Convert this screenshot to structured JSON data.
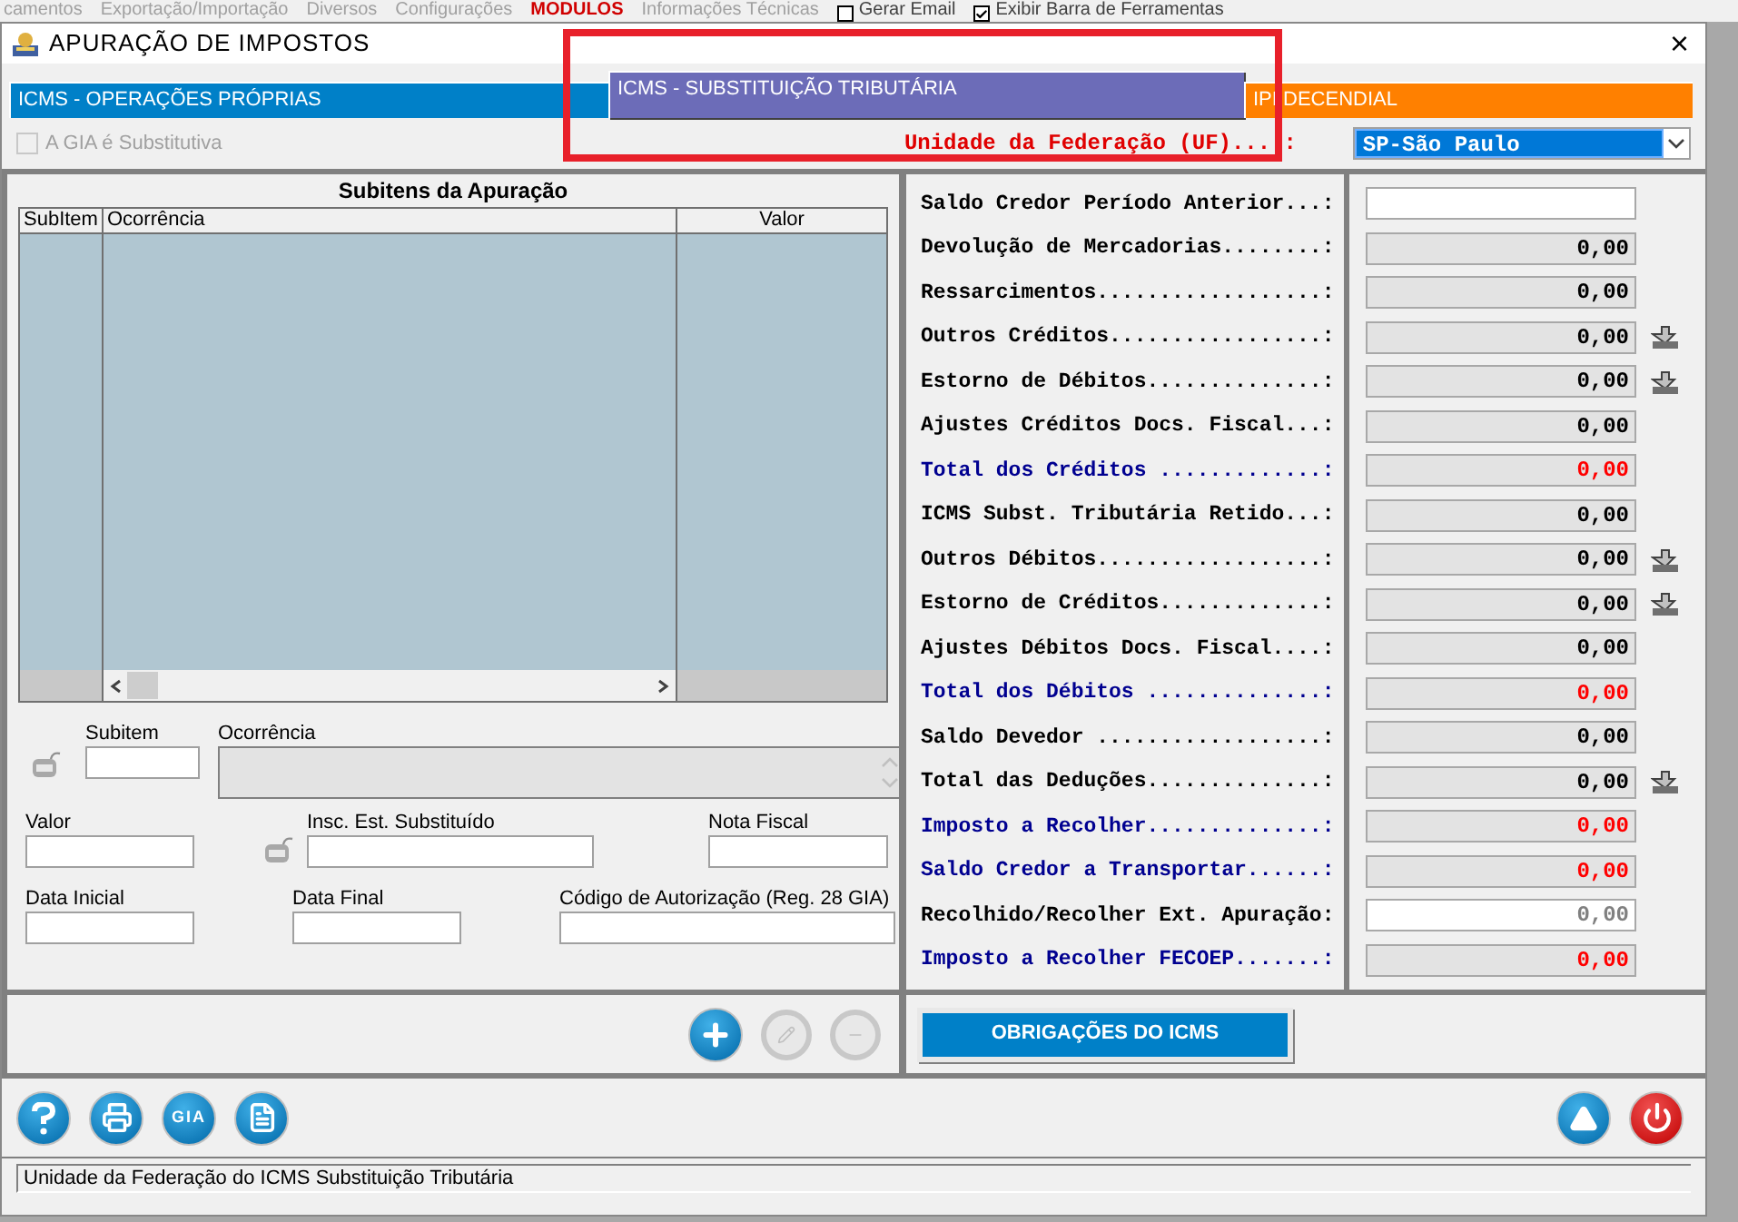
{
  "background_menu": {
    "items": [
      {
        "label": "camentos",
        "kind": "menu"
      },
      {
        "label": "Exportação/Importação",
        "kind": "menu"
      },
      {
        "label": "Diversos",
        "kind": "menu"
      },
      {
        "label": "Configurações",
        "kind": "menu"
      },
      {
        "label": "MODULOS",
        "kind": "highlight"
      },
      {
        "label": "Informações Técnicas",
        "kind": "menu"
      },
      {
        "label": "Gerar Email",
        "kind": "check",
        "checked": false
      },
      {
        "label": "Exibir Barra de Ferramentas",
        "kind": "check",
        "checked": true
      }
    ]
  },
  "window": {
    "title": "APURAÇÃO DE IMPOSTOS",
    "close": "×"
  },
  "tabs": [
    {
      "label": "ICMS - OPERAÇÕES PRÓPRIAS",
      "color": "#0080c8",
      "selected": false
    },
    {
      "label": "ICMS - SUBSTITUIÇÃO TRIBUTÁRIA",
      "color": "#6c6cb8",
      "selected": true
    },
    {
      "label": "IPI DECENDIAL",
      "color": "#ff8000",
      "selected": false
    }
  ],
  "gia_substitutiva": {
    "label": "A GIA é Substitutiva",
    "checked": false,
    "disabled": true
  },
  "uf": {
    "label": "Unidade da Federação (UF)....:",
    "value": "SP-São Paulo"
  },
  "subitens": {
    "title": "Subitens da Apuração",
    "columns": [
      "SubItem",
      "Ocorrência",
      "Valor"
    ]
  },
  "form": {
    "subitem": {
      "label": "Subitem"
    },
    "ocorrencia": {
      "label": "Ocorrência",
      "disabled": true
    },
    "valor": {
      "label": "Valor"
    },
    "insc": {
      "label": "Insc. Est. Substituído"
    },
    "nota": {
      "label": "Nota Fiscal"
    },
    "data_inicial": {
      "label": "Data Inicial"
    },
    "data_final": {
      "label": "Data Final"
    },
    "codigo": {
      "label": "Código de Autorização (Reg. 28 GIA)"
    }
  },
  "subitem_actions": [
    {
      "kind": "add",
      "disabled": false
    },
    {
      "kind": "edit",
      "disabled": true
    },
    {
      "kind": "delete",
      "disabled": true
    }
  ],
  "summary": [
    {
      "label": "Saldo Credor Período Anterior...:",
      "editable": true,
      "highlight": false,
      "detail": false
    },
    {
      "label": "Devolução de Mercadorias........:",
      "value": "0,00",
      "editable": false,
      "highlight": false,
      "detail": false
    },
    {
      "label": "Ressarcimentos..................:",
      "value": "0,00",
      "editable": false,
      "highlight": false,
      "detail": false
    },
    {
      "label": "Outros Créditos.................:",
      "value": "0,00",
      "editable": false,
      "highlight": false,
      "detail": true
    },
    {
      "label": "Estorno de Débitos..............:",
      "value": "0,00",
      "editable": false,
      "highlight": false,
      "detail": true
    },
    {
      "label": "Ajustes Créditos Docs. Fiscal...:",
      "value": "0,00",
      "editable": false,
      "highlight": false,
      "detail": false
    },
    {
      "label": "Total dos Créditos .............:",
      "value": "0,00",
      "editable": false,
      "highlight": true,
      "detail": false
    },
    {
      "label": "ICMS Subst. Tributária Retido...:",
      "value": "0,00",
      "editable": false,
      "highlight": false,
      "detail": false
    },
    {
      "label": "Outros Débitos..................:",
      "value": "0,00",
      "editable": false,
      "highlight": false,
      "detail": true
    },
    {
      "label": "Estorno de Créditos.............:",
      "value": "0,00",
      "editable": false,
      "highlight": false,
      "detail": true
    },
    {
      "label": "Ajustes Débitos Docs. Fiscal....:",
      "value": "0,00",
      "editable": false,
      "highlight": false,
      "detail": false
    },
    {
      "label": "Total dos Débitos ..............:",
      "value": "0,00",
      "editable": false,
      "highlight": true,
      "detail": false
    },
    {
      "label": "Saldo Devedor ..................:",
      "value": "0,00",
      "editable": false,
      "highlight": false,
      "detail": false
    },
    {
      "label": "Total das Deduções..............:",
      "value": "0,00",
      "editable": false,
      "highlight": false,
      "detail": true
    },
    {
      "label": "Imposto a Recolher..............:",
      "value": "0,00",
      "editable": false,
      "highlight": true,
      "detail": false
    },
    {
      "label": "Saldo Credor a Transportar......:",
      "value": "0,00",
      "editable": false,
      "highlight": true,
      "detail": false
    },
    {
      "label": "Recolhido/Recolher Ext. Apuração:",
      "value": "0,00",
      "editable": true,
      "highlight": false,
      "detail": false
    },
    {
      "label": "Imposto a Recolher FECOEP.......:",
      "value": "0,00",
      "editable": false,
      "highlight": true,
      "detail": false
    }
  ],
  "obrigacoes_button": "OBRIGAÇÕES DO ICMS",
  "toolbar_left": [
    {
      "kind": "help"
    },
    {
      "kind": "print"
    },
    {
      "kind": "gia",
      "label": "GIA"
    },
    {
      "kind": "document"
    }
  ],
  "toolbar_right": [
    {
      "kind": "up"
    },
    {
      "kind": "power"
    }
  ],
  "status_bar": "Unidade da Federação do ICMS Substituição Tributária"
}
